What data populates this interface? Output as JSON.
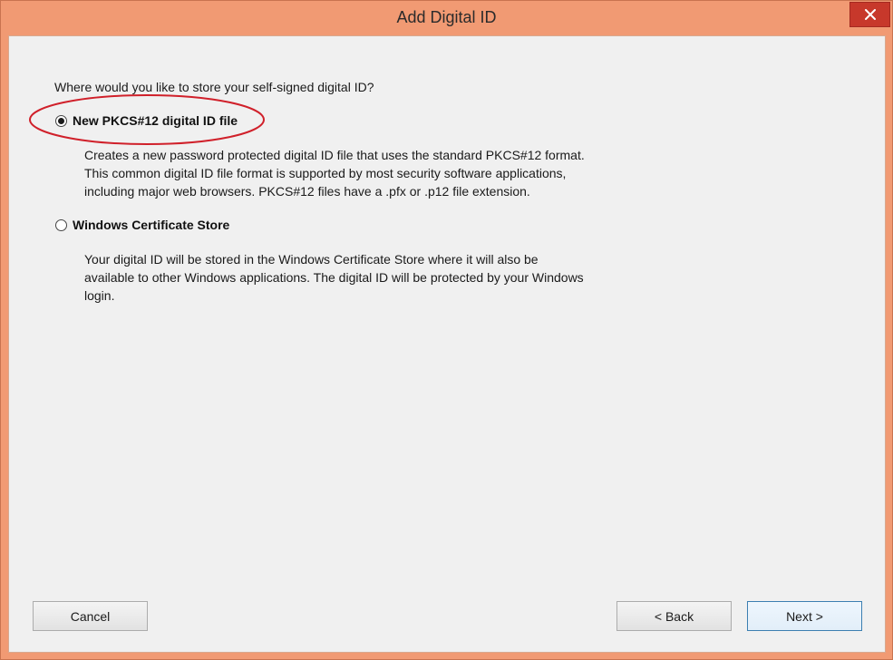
{
  "window": {
    "title": "Add Digital ID",
    "close_icon": "close-icon"
  },
  "dialog": {
    "question": "Where would you like to store your self-signed digital ID?",
    "options": [
      {
        "label": "New PKCS#12 digital ID file",
        "selected": true,
        "description": [
          "Creates a new password protected digital ID file that uses the standard PKCS#12 format.",
          "This common digital ID file format is supported by most security software applications,",
          "including major web browsers. PKCS#12 files have a .pfx or .p12 file extension."
        ]
      },
      {
        "label": "Windows Certificate Store",
        "selected": false,
        "description": [
          "Your digital ID will be stored in the Windows Certificate Store where it will also be",
          "available to other Windows applications. The digital ID will be protected by your Windows",
          "login."
        ]
      }
    ]
  },
  "buttons": {
    "cancel": "Cancel",
    "back": "< Back",
    "next": "Next >"
  },
  "colors": {
    "title_bar": "#f19a73",
    "close_button": "#c7382b",
    "annotation_ellipse": "#d0202a"
  }
}
